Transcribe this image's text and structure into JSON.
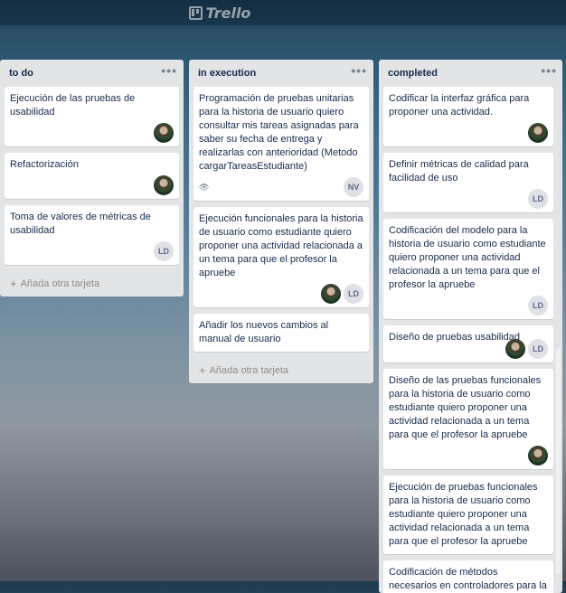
{
  "app": {
    "logo_text": "Trello",
    "logo_icon": "trello-icon"
  },
  "lists": [
    {
      "title": "to do",
      "menu": "•••",
      "add_label": "Añada otra tarjeta",
      "cards": [
        {
          "text": "Ejecución de las pruebas de usabilidad",
          "members": [
            "photo"
          ]
        },
        {
          "text": "Refactorización",
          "members": [
            "photo"
          ]
        },
        {
          "text": "Toma de valores de métricas de usabilidad",
          "members": [
            "LD"
          ]
        }
      ]
    },
    {
      "title": "in execution",
      "menu": "•••",
      "add_label": "Añada otra tarjeta",
      "cards": [
        {
          "text": "Programación de pruebas unitarias para la historia de usuario quiero consultar mis tareas asignadas para saber su fecha de entrega y realizarlas con anterioridad (Metodo cargarTareasEstudiante)",
          "watch_icon": "eye-icon",
          "members": [
            "NV"
          ]
        },
        {
          "text": "Ejecución funcionales para la historia de usuario como estudiante quiero proponer una actividad relacionada a un tema para que el profesor la apruebe",
          "members": [
            "photo",
            "LD"
          ]
        },
        {
          "text": "Añadir los nuevos cambios al manual de usuario",
          "members": []
        }
      ]
    },
    {
      "title": "completed",
      "menu": "•••",
      "cards": [
        {
          "text": "Codificar la interfaz gráfica para proponer una actividad.",
          "members": [
            "photo"
          ]
        },
        {
          "text": "Definir métricas de calidad para facilidad de uso",
          "members": [
            "LD"
          ]
        },
        {
          "text": "Codificación del modelo para la historia de usuario como estudiante quiero proponer una actividad relacionada a un tema para que el profesor la apruebe",
          "members": [
            "LD"
          ]
        },
        {
          "text": "Diseño de pruebas usabilidad",
          "members": [
            "photo",
            "LD"
          ]
        },
        {
          "text": "Diseño de las pruebas funcionales para la historia de usuario como estudiante quiero proponer una actividad relacionada a un tema para que el profesor la apruebe",
          "members": [
            "photo"
          ]
        },
        {
          "text": "Ejecución de pruebas funcionales para la historia de usuario como estudiante quiero proponer una actividad relacionada a un tema para que el profesor la apruebe",
          "members": []
        },
        {
          "text": "Codificación de métodos necesarios en controladores para la historia de",
          "members": []
        }
      ]
    }
  ]
}
